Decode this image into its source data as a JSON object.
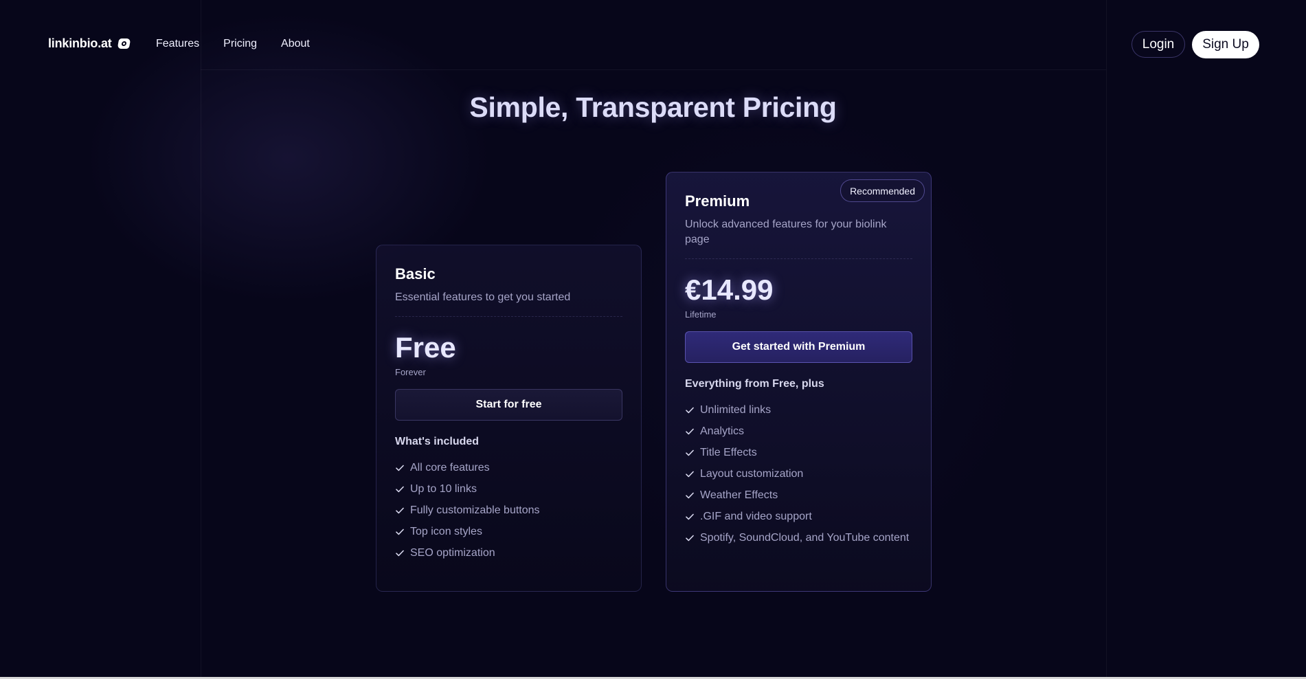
{
  "nav": {
    "brand": "linkinbio.at",
    "links": [
      "Features",
      "Pricing",
      "About"
    ],
    "login_label": "Login",
    "signup_label": "Sign Up"
  },
  "page_title": "Simple, Transparent Pricing",
  "plans": [
    {
      "name": "Basic",
      "description": "Essential features to get you started",
      "price": "Free",
      "period": "Forever",
      "cta_label": "Start for free",
      "includes_title": "What's included",
      "features": [
        "All core features",
        "Up to 10 links",
        "Fully customizable buttons",
        "Top icon styles",
        "SEO optimization"
      ]
    },
    {
      "name": "Premium",
      "badge": "Recommended",
      "description": "Unlock advanced features for your biolink page",
      "price": "€14.99",
      "period": "Lifetime",
      "cta_label": "Get started with Premium",
      "includes_title": "Everything from Free, plus",
      "features": [
        "Unlimited links",
        "Analytics",
        "Title Effects",
        "Layout customization",
        "Weather Effects",
        ".GIF and video support",
        "Spotify, SoundCloud, and YouTube content"
      ]
    }
  ],
  "icons": {
    "brand": "link-icon",
    "check": "check-icon"
  },
  "colors": {
    "background": "#07061a",
    "accent": "#2f2a78",
    "title": "#dcdcf8"
  }
}
